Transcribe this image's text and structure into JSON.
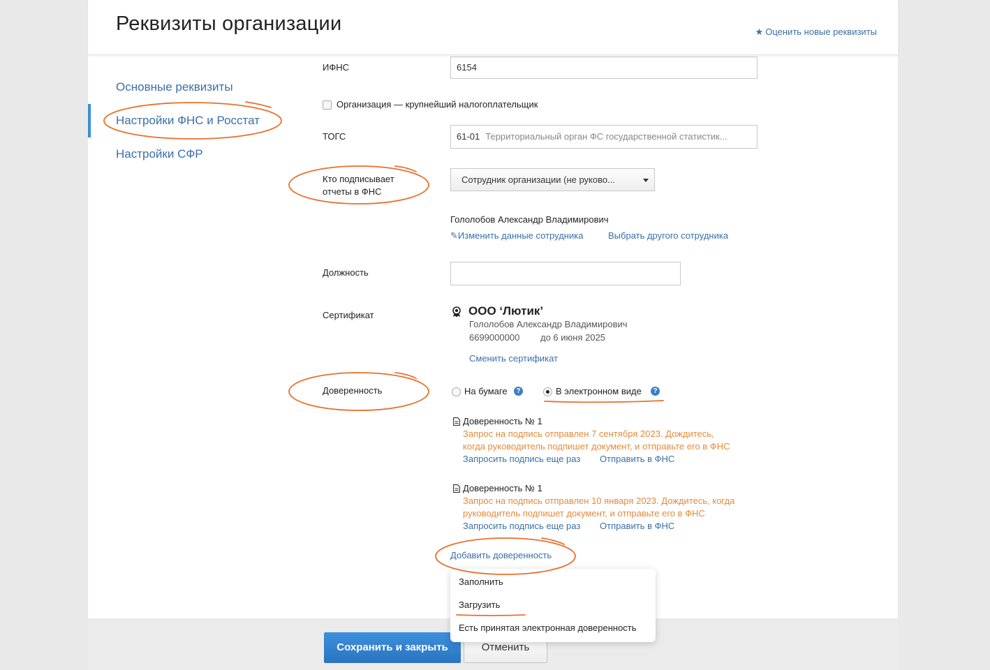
{
  "header": {
    "title": "Реквизиты организации",
    "rate_link": "Оценить новые реквизиты"
  },
  "sidebar": {
    "items": [
      {
        "label": "Основные реквизиты"
      },
      {
        "label": "Настройки ФНС и Росстат"
      },
      {
        "label": "Настройки СФР"
      }
    ]
  },
  "form": {
    "ifns": {
      "label": "ИФНС",
      "value": "6154"
    },
    "largest_taxpayer": {
      "label": "Организация — крупнейший налогоплательщик",
      "checked": false
    },
    "togs": {
      "label": "ТОГС",
      "code": "61-01",
      "name": "Территориальный орган ФС государственной статистик..."
    },
    "signer": {
      "label_line1": "Кто подписывает",
      "label_line2": "отчеты в ФНС",
      "selected": "Сотрудник организации (не руково...",
      "employee_name": "Гололобов Александр Владимирович",
      "edit_link": "Изменить данные сотрудника",
      "choose_link": "Выбрать другого сотрудника"
    },
    "position": {
      "label": "Должность",
      "value": ""
    },
    "certificate": {
      "label": "Сертификат",
      "org": "ООО ‘Лютик’",
      "owner": "Гололобов Александр Владимирович",
      "number": "6699000000",
      "valid_until": "до 6 июня 2025",
      "change_link": "Сменить сертификат"
    },
    "power_of_attorney": {
      "label": "Доверенность",
      "option_paper": "На бумаге",
      "option_electronic": "В электронном виде",
      "selected": "electronic",
      "documents": [
        {
          "title": "Доверенность № 1",
          "warn_line1": "Запрос на подпись отправлен 7 сентября 2023. Дождитесь,",
          "warn_line2": "когда руководитель подпишет документ, и отправьте его в ФНС",
          "request_link": "Запросить подпись еще раз",
          "send_link": "Отправить в ФНС"
        },
        {
          "title": "Доверенность № 1",
          "warn_line1": "Запрос на подпись отправлен 10 января 2023. Дождитесь, когда",
          "warn_line2": "руководитель подпишет документ, и отправьте его в ФНС",
          "request_link": "Запросить подпись еще раз",
          "send_link": "Отправить в ФНС"
        }
      ],
      "add_link": "Добавить доверенность",
      "menu": [
        "Заполнить",
        "Загрузить",
        "Есть принятая электронная доверенность"
      ]
    }
  },
  "footer": {
    "save_button": "Сохранить и закрыть",
    "cancel_button": "Отменить"
  },
  "colors": {
    "link": "#3a6fa8",
    "warning": "#e48a3b",
    "primary_button": "#2f7fcf",
    "annotation": "#ea6f2b"
  }
}
